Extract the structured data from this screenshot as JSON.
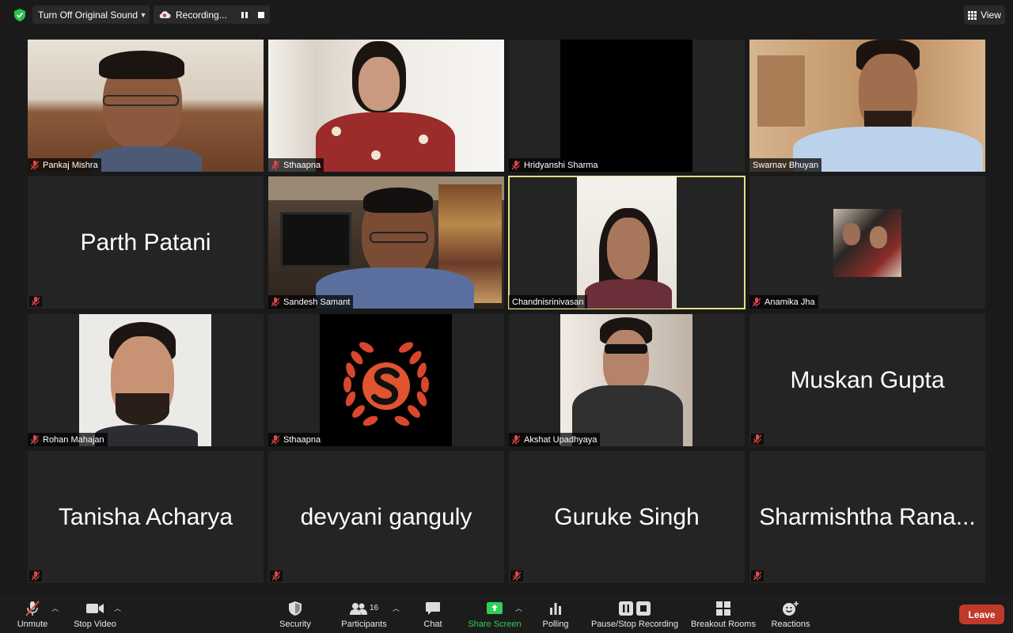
{
  "topbar": {
    "sound_label": "Turn Off Original Sound",
    "recording_label": "Recording...",
    "view_label": "View"
  },
  "tiles": [
    {
      "name": "Pankaj Mishra"
    },
    {
      "name": "Sthaapna"
    },
    {
      "name": "Hridyanshi Sharma"
    },
    {
      "name": "Swarnav Bhuyan"
    },
    {
      "name": "Parth Patani"
    },
    {
      "name": "Sandesh Samant"
    },
    {
      "name": "Chandnisrinivasan"
    },
    {
      "name": "Anamika Jha"
    },
    {
      "name": "Rohan Mahajan"
    },
    {
      "name": "Sthaapna"
    },
    {
      "name": "Akshat Upadhyaya"
    },
    {
      "name": "Muskan Gupta"
    },
    {
      "name": "Tanisha Acharya"
    },
    {
      "name": "devyani ganguly"
    },
    {
      "name": "Guruke Singh"
    },
    {
      "name": "Sharmishtha Rana..."
    }
  ],
  "toolbar": {
    "unmute": "Unmute",
    "stop_video": "Stop Video",
    "security": "Security",
    "participants": "Participants",
    "participants_count": "16",
    "chat": "Chat",
    "share_screen": "Share Screen",
    "polling": "Polling",
    "pause_stop_recording": "Pause/Stop Recording",
    "breakout_rooms": "Breakout Rooms",
    "reactions": "Reactions",
    "leave": "Leave"
  },
  "colors": {
    "active_speaker_border": "#e6df82",
    "share_green": "#2ed158",
    "leave_red": "#c0392b",
    "muted_icon": "#e04848"
  }
}
